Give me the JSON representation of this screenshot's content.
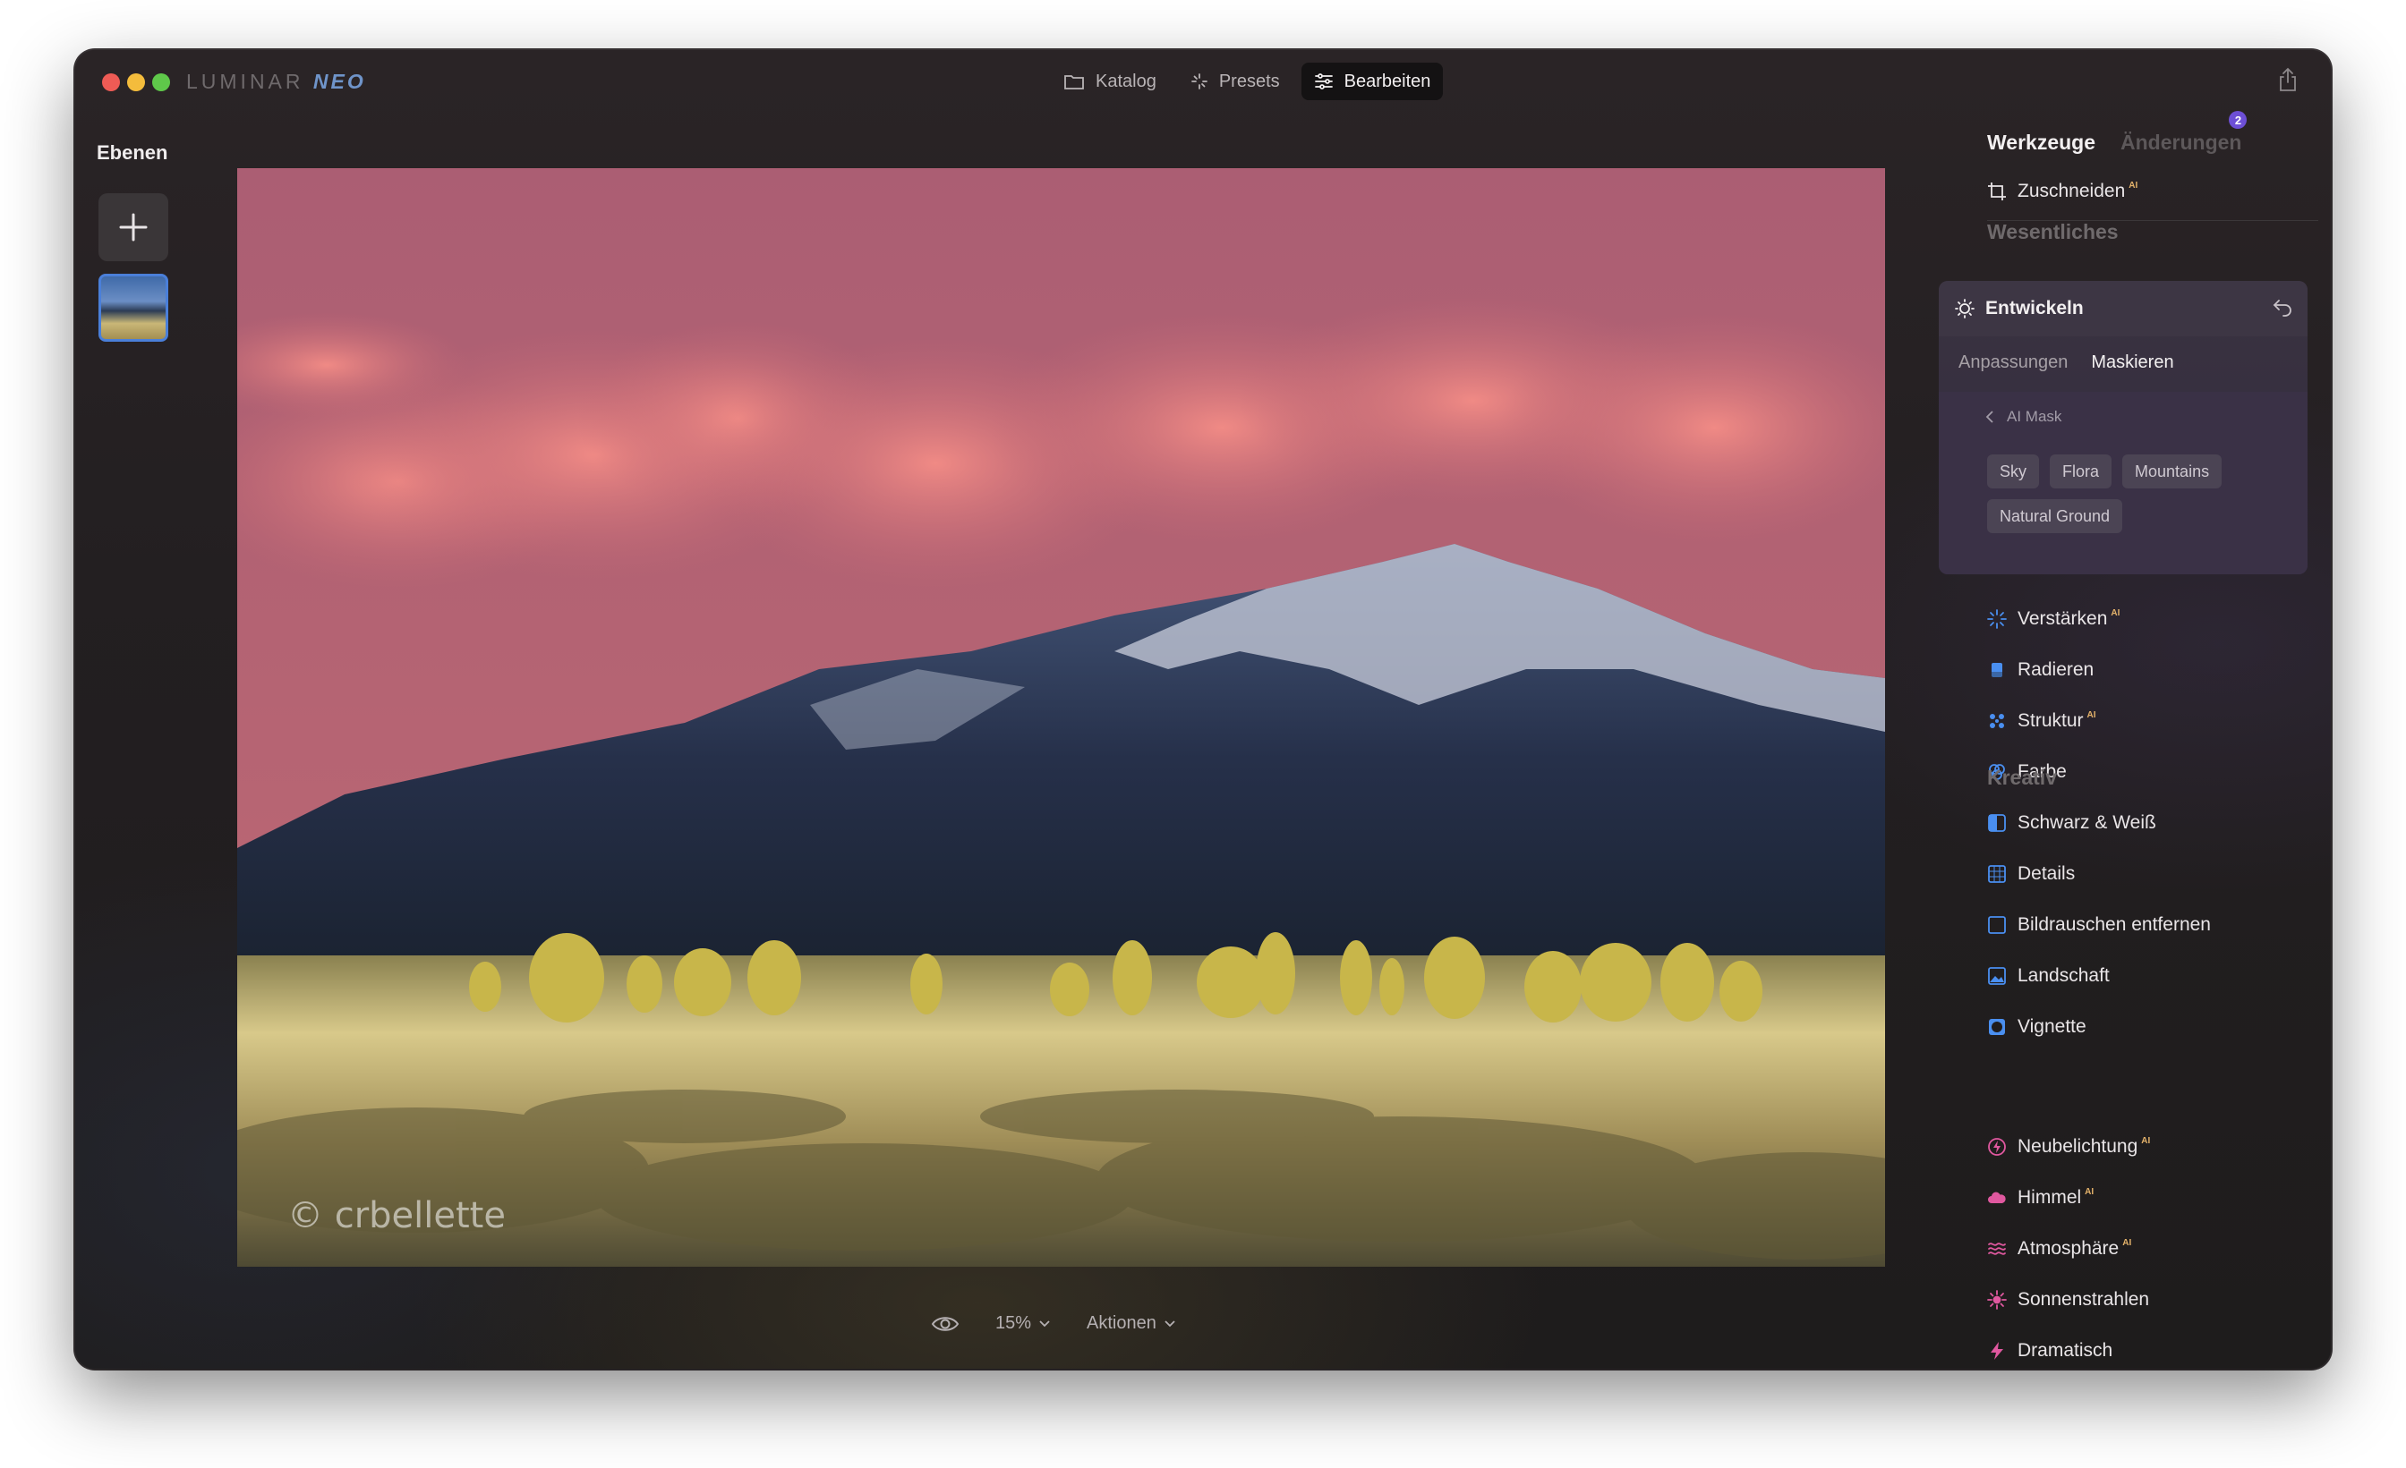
{
  "app": {
    "logo_main": "LUMINAR",
    "logo_accent": "NEO"
  },
  "topnav": {
    "catalog": "Katalog",
    "presets": "Presets",
    "edit": "Bearbeiten"
  },
  "layers": {
    "title": "Ebenen"
  },
  "canvas": {
    "watermark": "© crbellette"
  },
  "bottombar": {
    "zoom": "15%",
    "actions": "Aktionen"
  },
  "panel": {
    "tab_tools": "Werkzeuge",
    "tab_changes": "Änderungen",
    "changes_badge": "2",
    "crop": "Zuschneiden",
    "ai_tag": "AI",
    "section_essentials": "Wesentliches",
    "develop": {
      "title": "Entwickeln",
      "tab_adjust": "Anpassungen",
      "tab_mask": "Maskieren",
      "ai_mask": "AI Mask",
      "chips": [
        "Sky",
        "Flora",
        "Mountains",
        "Natural Ground"
      ]
    },
    "essentials": [
      {
        "label": "Verstärken",
        "icon": "sparkle-icon",
        "ai": true
      },
      {
        "label": "Radieren",
        "icon": "eraser-icon",
        "ai": false
      },
      {
        "label": "Struktur",
        "icon": "dots-icon",
        "ai": true
      },
      {
        "label": "Farbe",
        "icon": "color-circles-icon",
        "ai": false
      },
      {
        "label": "Schwarz & Weiß",
        "icon": "half-square-icon",
        "ai": false
      },
      {
        "label": "Details",
        "icon": "grid-square-icon",
        "ai": false
      },
      {
        "label": "Bildrauschen entfernen",
        "icon": "noise-square-icon",
        "ai": false
      },
      {
        "label": "Landschaft",
        "icon": "landscape-icon",
        "ai": false
      },
      {
        "label": "Vignette",
        "icon": "vignette-icon",
        "ai": false
      }
    ],
    "section_creative": "Kreativ",
    "creative": [
      {
        "label": "Neubelichtung",
        "icon": "relight-icon",
        "ai": true
      },
      {
        "label": "Himmel",
        "icon": "cloud-icon",
        "ai": true
      },
      {
        "label": "Atmosphäre",
        "icon": "waves-icon",
        "ai": true
      },
      {
        "label": "Sonnenstrahlen",
        "icon": "sun-rays-icon",
        "ai": false
      },
      {
        "label": "Dramatisch",
        "icon": "bolt-icon",
        "ai": false
      }
    ],
    "colors": {
      "accent_blue": "#4a8ff0",
      "accent_pink": "#e0589f",
      "badge_purple": "#6d4fd6"
    }
  }
}
